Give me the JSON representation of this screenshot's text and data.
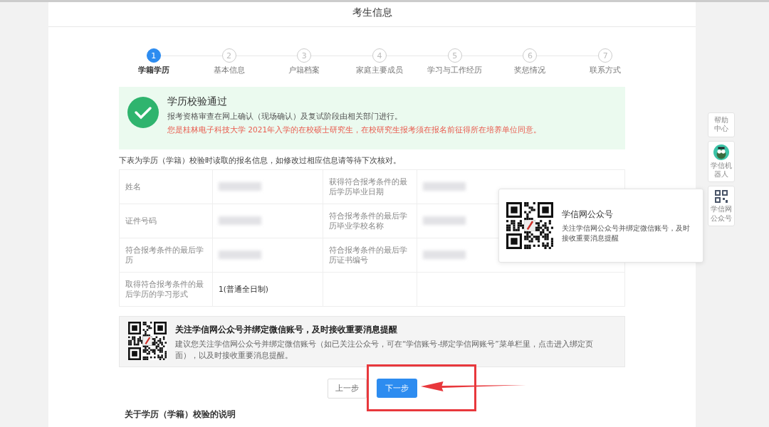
{
  "page_title": "考生信息",
  "steps": [
    {
      "number": "1",
      "label": "学籍学历",
      "selected": true
    },
    {
      "number": "2",
      "label": "基本信息",
      "selected": false
    },
    {
      "number": "3",
      "label": "户籍档案",
      "selected": false
    },
    {
      "number": "4",
      "label": "家庭主要成员",
      "selected": false
    },
    {
      "number": "5",
      "label": "学习与工作经历",
      "selected": false
    },
    {
      "number": "6",
      "label": "奖惩情况",
      "selected": false
    },
    {
      "number": "7",
      "label": "联系方式",
      "selected": false
    }
  ],
  "result": {
    "title": "学历校验通过",
    "note": "报考资格审查在网上确认（现场确认）及复试阶段由相关部门进行。",
    "warning": "您是桂林电子科技大学 2021年入学的在校硕士研究生，在校研究生报考须在报名前征得所在培养单位同意。"
  },
  "table_intro": "下表为学历（学籍）校验时读取的报名信息，如修改过相应信息请等待下次核对。",
  "table": {
    "rows": [
      [
        {
          "label": "姓名",
          "value": {
            "redacted": true
          }
        },
        {
          "label": "获得符合报考条件的最后学历毕业日期",
          "value": {
            "redacted": true
          }
        }
      ],
      [
        {
          "label": "证件号码",
          "value": {
            "redacted": true
          }
        },
        {
          "label": "符合报考条件的最后学历毕业学校名称",
          "value": {
            "redacted": true
          }
        }
      ],
      [
        {
          "label": "符合报考条件的最后学历",
          "value": {
            "redacted": true
          }
        },
        {
          "label": "符合报考条件的最后学历证书编号",
          "value": {
            "redacted": true
          }
        }
      ],
      [
        {
          "label": "取得符合报考条件的最后学历的学习形式",
          "value": {
            "text": "1(普通全日制)"
          }
        }
      ]
    ]
  },
  "notice": {
    "title": "关注学信网公众号并绑定微信账号，及时接收重要消息提醒",
    "text": "建议您关注学信网公众号并绑定微信账号（如已关注公众号，可在“学信账号-绑定学信网账号”菜单栏里，点击进入绑定页面），以及时接收重要消息提醒。"
  },
  "buttons": {
    "prev": "上一步",
    "next": "下一步"
  },
  "footer_heading": "关于学历（学籍）校验的说明",
  "popup": {
    "title": "学信网公众号",
    "text": "关注学信网公众号并绑定微信账号，及时接收重要消息提醒"
  },
  "side_tools": [
    {
      "kind": "text",
      "label": "帮助中心"
    },
    {
      "kind": "robot",
      "label": "学信机器人"
    },
    {
      "kind": "qr",
      "label": "学信网公众号"
    }
  ]
}
